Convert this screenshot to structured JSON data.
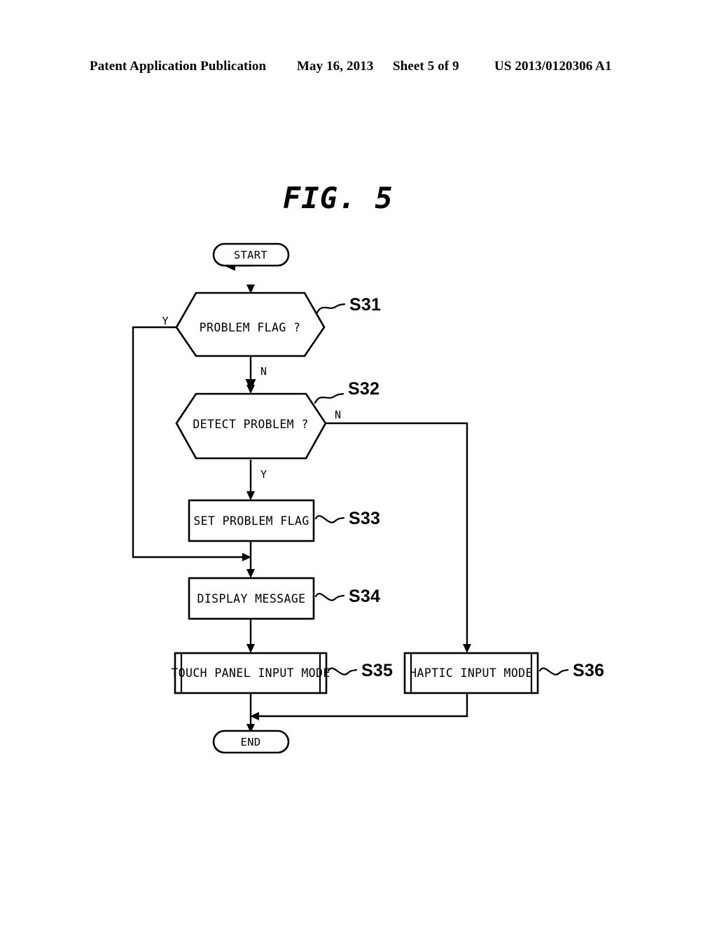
{
  "header": {
    "publication": "Patent Application Publication",
    "date": "May 16, 2013",
    "sheet": "Sheet 5 of 9",
    "patent_number": "US 2013/0120306 A1"
  },
  "figure": {
    "title": "FIG. 5"
  },
  "flowchart": {
    "nodes": {
      "start": {
        "label": "START",
        "shape": "terminator"
      },
      "s31": {
        "label": "PROBLEM FLAG ?",
        "shape": "decision-hexagon",
        "step": "S31"
      },
      "s32": {
        "label": "DETECT PROBLEM ?",
        "shape": "decision-hexagon",
        "step": "S32"
      },
      "s33": {
        "label": "SET PROBLEM FLAG",
        "shape": "process",
        "step": "S33"
      },
      "s34": {
        "label": "DISPLAY MESSAGE",
        "shape": "process",
        "step": "S34"
      },
      "s35": {
        "label": "TOUCH PANEL INPUT MODE",
        "shape": "predefined-process",
        "step": "S35"
      },
      "s36": {
        "label": "HAPTIC INPUT MODE",
        "shape": "predefined-process",
        "step": "S36"
      },
      "end": {
        "label": "END",
        "shape": "terminator"
      }
    },
    "branch_labels": {
      "s31_yes": "Y",
      "s31_no": "N",
      "s32_no": "N",
      "s32_yes": "Y"
    }
  },
  "colors": {
    "ink": "#000000",
    "paper": "#ffffff"
  }
}
